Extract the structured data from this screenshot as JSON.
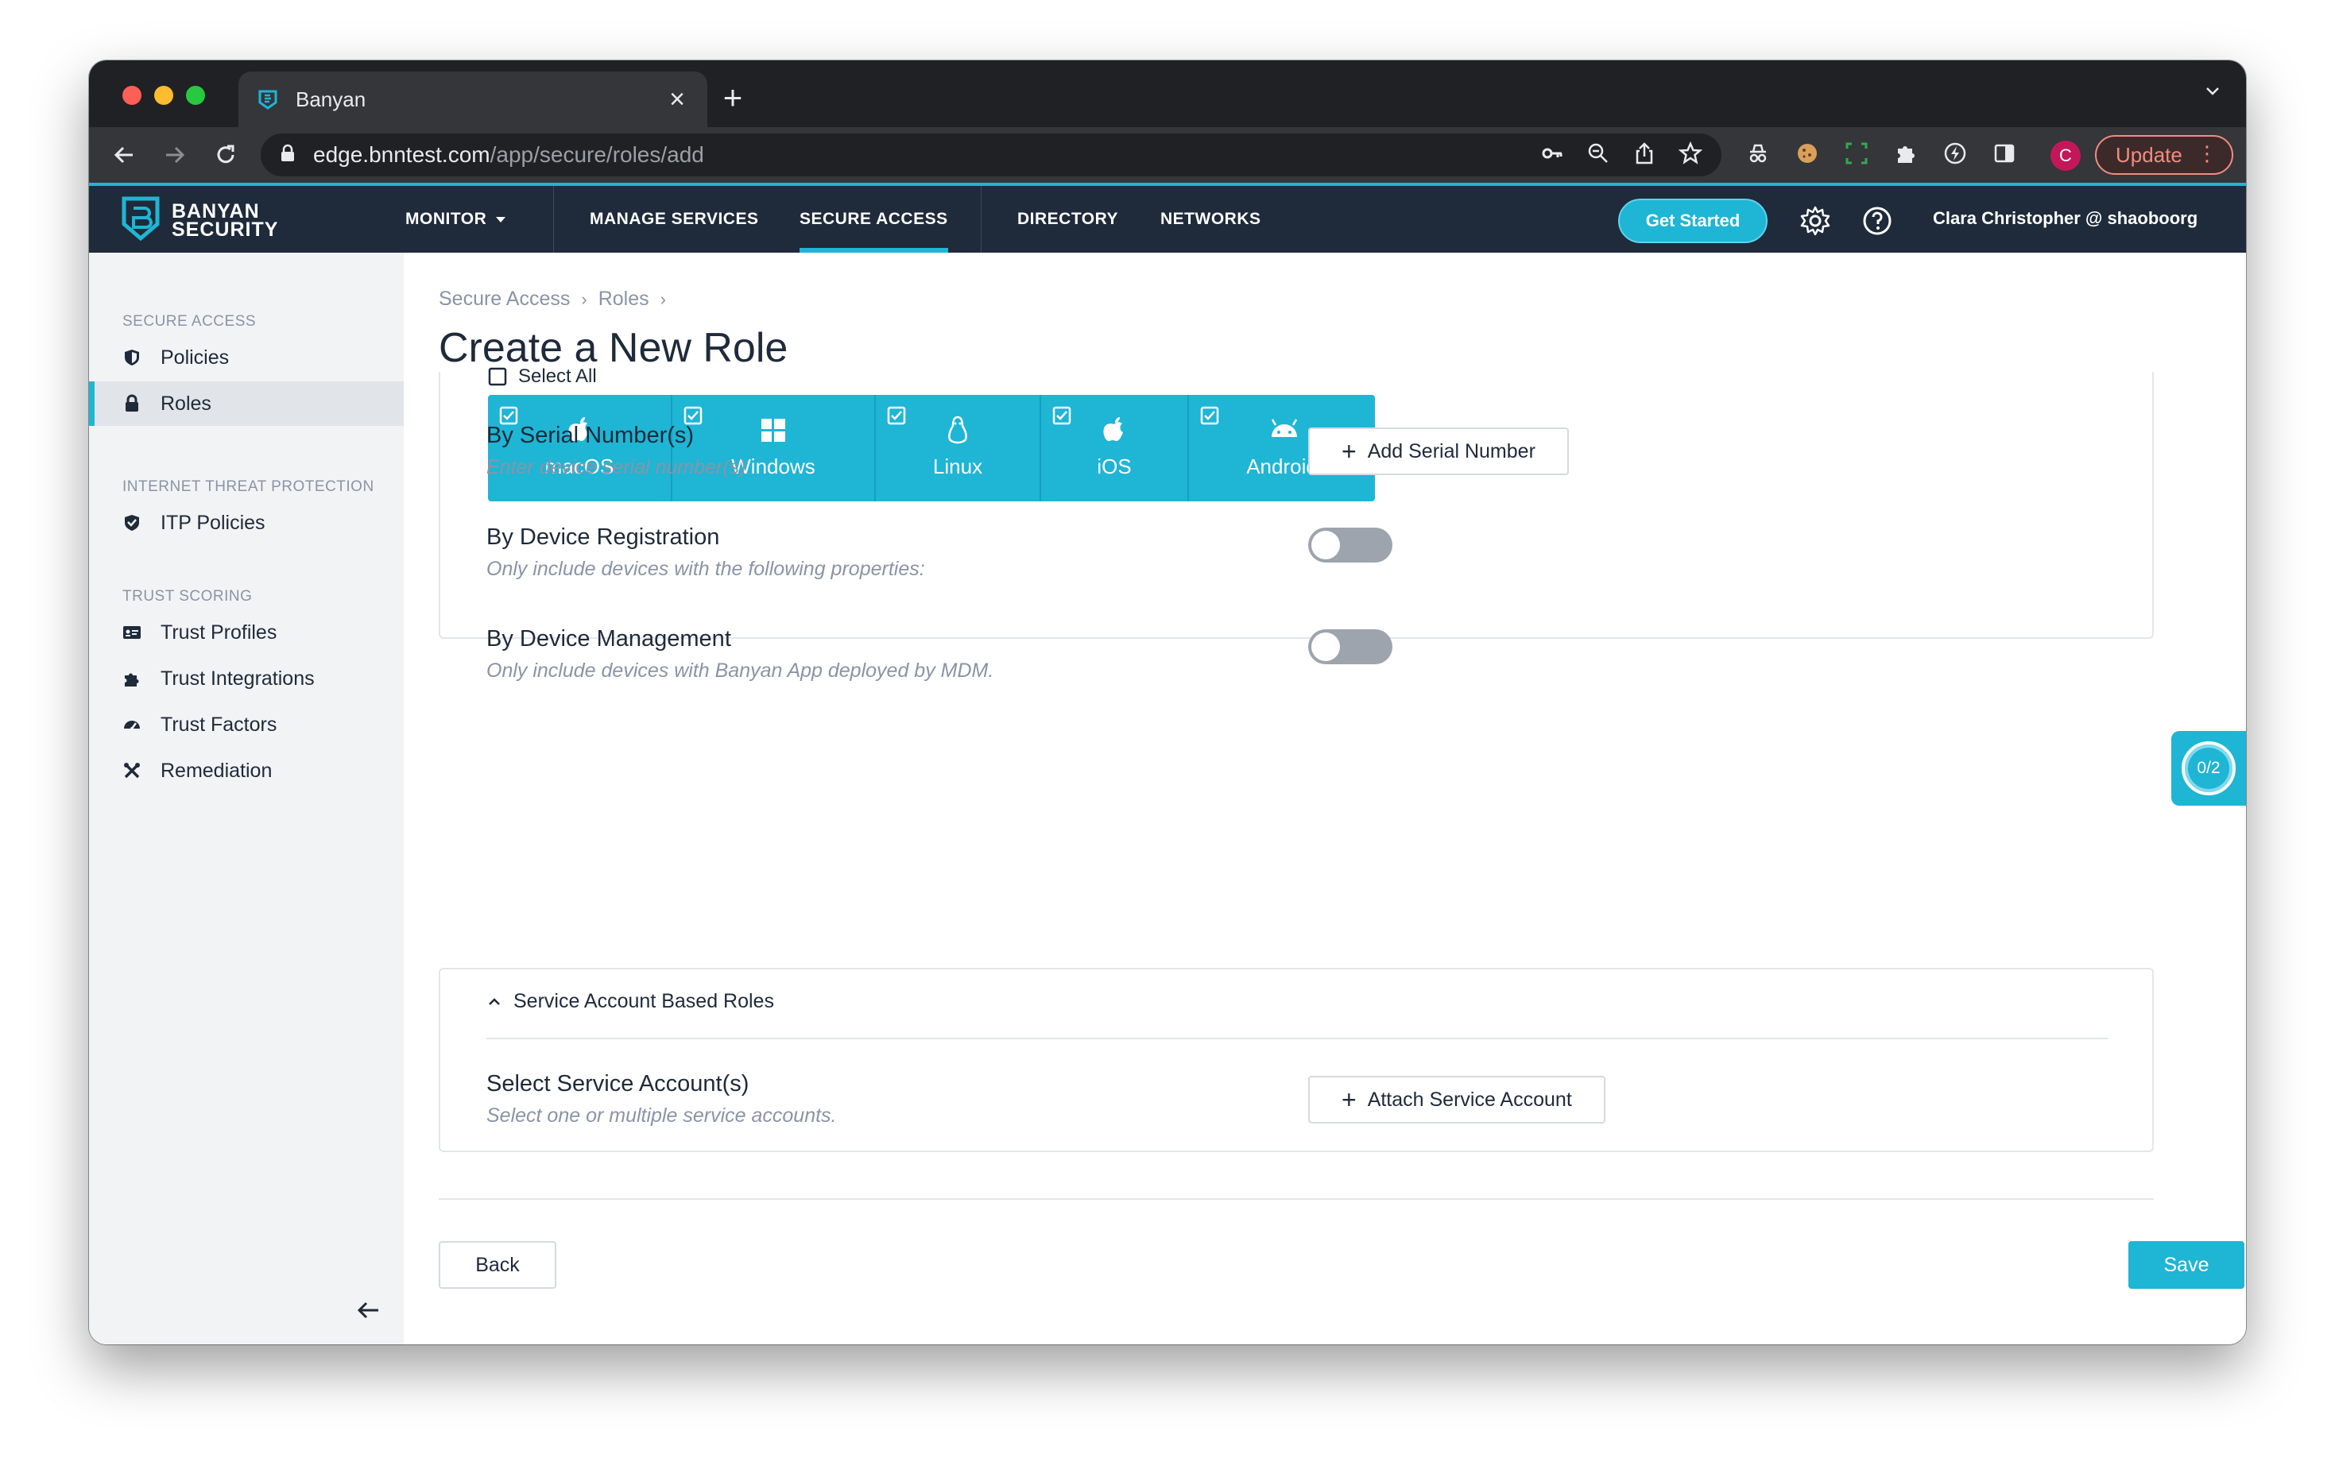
{
  "browser": {
    "tab_title": "Banyan",
    "url_host": "edge.bnntest.com",
    "url_path": "/app/secure/roles/add",
    "profile_initial": "C",
    "update_label": "Update"
  },
  "app": {
    "logo_line1": "BANYAN",
    "logo_line2": "SECURITY",
    "nav": {
      "monitor": "MONITOR",
      "manage_services": "MANAGE SERVICES",
      "secure_access": "SECURE ACCESS",
      "directory": "DIRECTORY",
      "networks": "NETWORKS"
    },
    "get_started": "Get Started",
    "user": "Clara Christopher @ shaoboorg",
    "accent_color": "#1fb5d5",
    "header_color": "#1f2a3a"
  },
  "sidebar": {
    "sections": [
      {
        "label": "SECURE ACCESS"
      },
      {
        "label": "INTERNET THREAT PROTECTION"
      },
      {
        "label": "TRUST SCORING"
      }
    ],
    "items": [
      {
        "label": "Policies",
        "icon": "shield-icon"
      },
      {
        "label": "Roles",
        "icon": "lock-icon",
        "active": true
      },
      {
        "label": "ITP Policies",
        "icon": "shield-check-icon"
      },
      {
        "label": "Trust Profiles",
        "icon": "id-card-icon"
      },
      {
        "label": "Trust Integrations",
        "icon": "puzzle-icon"
      },
      {
        "label": "Trust Factors",
        "icon": "gauge-icon"
      },
      {
        "label": "Remediation",
        "icon": "tools-icon"
      }
    ]
  },
  "main": {
    "breadcrumb": [
      "Secure Access",
      "Roles"
    ],
    "title": "Create a New Role",
    "select_all": "Select All",
    "platforms": [
      {
        "label": "macOS",
        "checked": true
      },
      {
        "label": "Windows",
        "checked": true
      },
      {
        "label": "Linux",
        "checked": true
      },
      {
        "label": "iOS",
        "checked": true
      },
      {
        "label": "Android",
        "checked": true
      }
    ],
    "serial": {
      "title": "By Serial Number(s)",
      "subtitle": "Enter device serial number(s).",
      "button": "Add Serial Number"
    },
    "registration": {
      "title": "By Device Registration",
      "subtitle": "Only include devices with the following properties:",
      "enabled": false
    },
    "management": {
      "title": "By Device Management",
      "subtitle": "Only include devices with Banyan App deployed by MDM.",
      "enabled": false
    },
    "service_account": {
      "section_title": "Service Account Based Roles",
      "title": "Select Service Account(s)",
      "subtitle": "Select one or multiple service accounts.",
      "button": "Attach Service Account"
    },
    "back_label": "Back",
    "save_label": "Save",
    "progress": "0/2"
  }
}
